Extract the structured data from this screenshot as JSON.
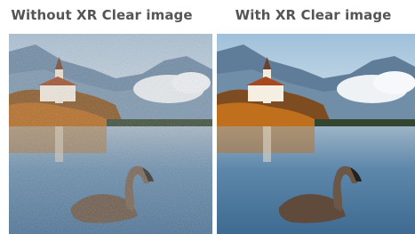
{
  "captions": {
    "left": "Without XR Clear image",
    "right": "With XR Clear image"
  },
  "scene": {
    "subject": "swan",
    "background": "lake with island church and mountains"
  },
  "colors": {
    "caption_text": "#555555",
    "sky": "#b9cfe0",
    "water": "#5d87aa"
  },
  "icons": []
}
